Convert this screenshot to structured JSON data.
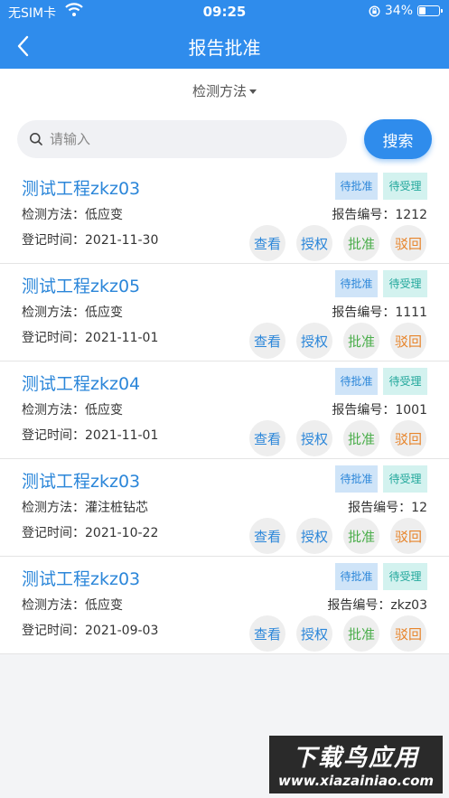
{
  "status": {
    "carrier": "无SIM卡",
    "time": "09:25",
    "battery": "34%",
    "battery_level": 0.34
  },
  "nav": {
    "title": "报告批准"
  },
  "filter": {
    "label": "检测方法"
  },
  "search": {
    "placeholder": "请输入",
    "value": "",
    "button": "搜索"
  },
  "labels": {
    "method": "检测方法：",
    "report": "报告编号：",
    "date": "登记时间：",
    "tag_pending": "待批准",
    "tag_accept": "待受理",
    "view": "查看",
    "auth": "授权",
    "approve": "批准",
    "reject": "驳回"
  },
  "records": [
    {
      "name": "测试工程zkz03",
      "method": "低应变",
      "report_no": "1212",
      "date": "2021-11-30"
    },
    {
      "name": "测试工程zkz05",
      "method": "低应变",
      "report_no": "1111",
      "date": "2021-11-01"
    },
    {
      "name": "测试工程zkz04",
      "method": "低应变",
      "report_no": "1001",
      "date": "2021-11-01"
    },
    {
      "name": "测试工程zkz03",
      "method": "灌注桩钻芯",
      "report_no": "12",
      "date": "2021-10-22"
    },
    {
      "name": "测试工程zkz03",
      "method": "低应变",
      "report_no": "zkz03",
      "date": "2021-09-03"
    }
  ],
  "watermark": {
    "title": "下载鸟应用",
    "url": "www.xiazainiao.com"
  },
  "colors": {
    "primary": "#2f8cec",
    "link": "#2b86d9",
    "approve": "#4cae4c",
    "reject": "#e7842a",
    "accept_tag": "#21a79b"
  }
}
